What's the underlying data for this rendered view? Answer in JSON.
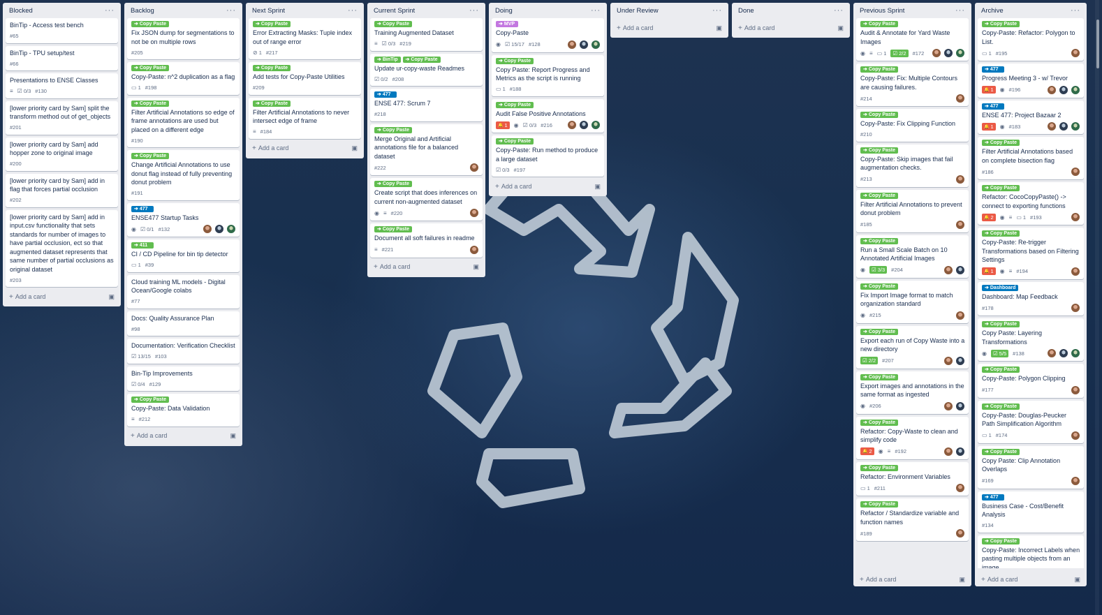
{
  "colors": {
    "green": "#61bd4f",
    "blue": "#0079bf",
    "purple": "#c377e0",
    "red": "#eb5a46"
  },
  "add_card_label": "Add a card",
  "lists": [
    {
      "title": "Blocked",
      "cards": [
        {
          "title": "BinTip - Access test bench",
          "num": "#65"
        },
        {
          "title": "BinTip - TPU setup/test",
          "num": "#66"
        },
        {
          "title": "Presentations to ENSE Classes",
          "check": "0/3",
          "desc": true,
          "num": "#130"
        },
        {
          "title": "[lower priority card by Sam] split the transform method out of get_objects",
          "num": "#201"
        },
        {
          "title": "[lower priority card by Sam] add hopper zone to original image",
          "num": "#200"
        },
        {
          "title": "[lower priority card by Sam] add in flag that forces partial occlusion",
          "num": "#202"
        },
        {
          "title": "[lower priority card by Sam] add in input.csv functionality that sets standards for number of images to have partial occlusion, ect so that augmented dataset represents that same number of partial occlusions as original dataset",
          "num": "#203"
        }
      ]
    },
    {
      "title": "Backlog",
      "cards": [
        {
          "labels": [
            {
              "text": "Copy Paste",
              "color": "green"
            }
          ],
          "title": "Fix JSON dump for segmentations to not be on multiple rows",
          "num": "#205"
        },
        {
          "labels": [
            {
              "text": "Copy Paste",
              "color": "green"
            }
          ],
          "title": "Copy-Paste: n^2 duplication as a flag",
          "comments": "1",
          "num": "#198"
        },
        {
          "labels": [
            {
              "text": "Copy Paste",
              "color": "green"
            }
          ],
          "title": "Filter Artificial Annotations so edge of frame annotations are used but placed on a different edge",
          "num": "#190"
        },
        {
          "labels": [
            {
              "text": "Copy Paste",
              "color": "green"
            }
          ],
          "title": "Change Artificial Annotations to use donut flag instead of fully preventing donut problem",
          "num": "#191"
        },
        {
          "labels": [
            {
              "text": "477",
              "color": "blue"
            }
          ],
          "title": "ENSE477 Startup Tasks",
          "watch": true,
          "check": "0/1",
          "num": "#132",
          "avatars": 3
        },
        {
          "labels": [
            {
              "text": "411",
              "color": "green"
            }
          ],
          "title": "CI / CD Pipeline for bin tip detector",
          "comments": "1",
          "num": "#39"
        },
        {
          "title": "Cloud training ML models - Digital Ocean/Google colabs",
          "num": "#77"
        },
        {
          "title": "Docs: Quality Assurance Plan",
          "num": "#98"
        },
        {
          "title": "Documentation: Verification Checklist",
          "check": "13/15",
          "num": "#103"
        },
        {
          "title": "Bin-Tip Improvements",
          "check": "0/4",
          "num": "#129"
        },
        {
          "labels": [
            {
              "text": "Copy Paste",
              "color": "green"
            }
          ],
          "title": "Copy-Paste: Data Validation",
          "desc": true,
          "num": "#212"
        }
      ]
    },
    {
      "title": "Next Sprint",
      "cards": [
        {
          "labels": [
            {
              "text": "Copy Paste",
              "color": "green"
            }
          ],
          "title": "Error Extracting Masks: Tuple index out of range error",
          "attach": "1",
          "num": "#217"
        },
        {
          "labels": [
            {
              "text": "Copy Paste",
              "color": "green"
            }
          ],
          "title": "Add tests for Copy-Paste Utilities",
          "num": "#209"
        },
        {
          "labels": [
            {
              "text": "Copy Paste",
              "color": "green"
            }
          ],
          "title": "Filter Artificial Annotations to never intersect edge of frame",
          "desc": true,
          "num": "#184"
        }
      ]
    },
    {
      "title": "Current Sprint",
      "cards": [
        {
          "labels": [
            {
              "text": "Copy Paste",
              "color": "green"
            }
          ],
          "title": "Training Augmented Dataset",
          "desc": true,
          "check": "0/3",
          "num": "#219"
        },
        {
          "labels": [
            {
              "text": "BinTip",
              "color": "green"
            },
            {
              "text": "Copy Paste",
              "color": "green"
            }
          ],
          "title": "Update ur-copy-waste Readmes",
          "check": "0/2",
          "num": "#208"
        },
        {
          "labels": [
            {
              "text": "477",
              "color": "blue"
            }
          ],
          "title": "ENSE 477: Scrum 7",
          "num": "#218"
        },
        {
          "labels": [
            {
              "text": "Copy Paste",
              "color": "green"
            }
          ],
          "title": "Merge Original and Artificial annotations file for a balanced dataset",
          "num": "#222",
          "avatars": 1
        },
        {
          "labels": [
            {
              "text": "Copy Paste",
              "color": "green"
            }
          ],
          "title": "Create script that does inferences on current non-augmented dataset",
          "watch": true,
          "desc": true,
          "num": "#220",
          "avatars": 1
        },
        {
          "labels": [
            {
              "text": "Copy Paste",
              "color": "green"
            }
          ],
          "title": "Document all soft failures in readme",
          "desc": true,
          "num": "#221",
          "avatars": 1
        }
      ]
    },
    {
      "title": "Doing",
      "cards": [
        {
          "labels": [
            {
              "text": "MVP",
              "color": "purple"
            }
          ],
          "title": "Copy-Paste",
          "watch": true,
          "check": "15/17",
          "num": "#128",
          "avatars": 3
        },
        {
          "labels": [
            {
              "text": "Copy Paste",
              "color": "green"
            }
          ],
          "title": "Copy Paste: Report Progress and Metrics as the script is running",
          "comments": "1",
          "num": "#188"
        },
        {
          "labels": [
            {
              "text": "Copy Paste",
              "color": "green"
            }
          ],
          "title": "Audit False Positive Annotations",
          "alert": "1",
          "watch": true,
          "check": "0/3",
          "num": "#216",
          "avatars": 3
        },
        {
          "labels": [
            {
              "text": "Copy Paste",
              "color": "green"
            }
          ],
          "title": "Copy-Paste: Run method to produce a large dataset",
          "check": "0/3",
          "num": "#197"
        }
      ]
    },
    {
      "title": "Under Review",
      "cards": []
    },
    {
      "title": "Done",
      "cards": []
    },
    {
      "title": "Previous Sprint",
      "cards": [
        {
          "labels": [
            {
              "text": "Copy Paste",
              "color": "green"
            }
          ],
          "title": "Audit & Annotate for Yard Waste Images",
          "watch": true,
          "desc": true,
          "comments": "1",
          "checkgreen": "2/2",
          "num": "#172",
          "avatars": 3
        },
        {
          "labels": [
            {
              "text": "Copy Paste",
              "color": "green"
            }
          ],
          "title": "Copy-Paste: Fix: Multiple Contours are causing failures.",
          "num": "#214",
          "avatars": 1
        },
        {
          "labels": [
            {
              "text": "Copy Paste",
              "color": "green"
            }
          ],
          "title": "Copy-Paste: Fix Clipping Function",
          "num": "#210"
        },
        {
          "labels": [
            {
              "text": "Copy Paste",
              "color": "green"
            }
          ],
          "title": "Copy-Paste: Skip images that fail augmentation checks.",
          "num": "#213",
          "avatars": 1
        },
        {
          "labels": [
            {
              "text": "Copy Paste",
              "color": "green"
            }
          ],
          "title": "Filter Artificial Annotations to prevent donut problem",
          "num": "#185",
          "avatars": 1
        },
        {
          "labels": [
            {
              "text": "Copy Paste",
              "color": "green"
            }
          ],
          "title": "Run a Small Scale Batch on 10 Annotated Artificial Images",
          "watch": true,
          "checkgreen": "3/3",
          "num": "#204",
          "avatars": 2
        },
        {
          "labels": [
            {
              "text": "Copy Paste",
              "color": "green"
            }
          ],
          "title": "Fix Import Image format to match organization standard",
          "watch": true,
          "num": "#215",
          "avatars": 1
        },
        {
          "labels": [
            {
              "text": "Copy Paste",
              "color": "green"
            }
          ],
          "title": "Export each run of Copy Waste into a new directory",
          "checkgreen": "2/2",
          "num": "#207",
          "avatars": 2
        },
        {
          "labels": [
            {
              "text": "Copy Paste",
              "color": "green"
            }
          ],
          "title": "Export images and annotations in the same format as ingested",
          "watch": true,
          "num": "#206",
          "avatars": 2
        },
        {
          "labels": [
            {
              "text": "Copy Paste",
              "color": "green"
            }
          ],
          "title": "Refactor: Copy-Waste to clean and simplify code",
          "alert": "2",
          "watch": true,
          "desc": true,
          "num": "#192",
          "avatars": 2
        },
        {
          "labels": [
            {
              "text": "Copy Paste",
              "color": "green"
            }
          ],
          "title": "Refactor: Environment Variables",
          "comments": "1",
          "num": "#211",
          "avatars": 1
        },
        {
          "labels": [
            {
              "text": "Copy Paste",
              "color": "green"
            }
          ],
          "title": "Refactor / Standardize variable and function names",
          "num": "#189",
          "avatars": 1
        }
      ]
    },
    {
      "title": "Archive",
      "cards": [
        {
          "labels": [
            {
              "text": "Copy Paste",
              "color": "green"
            }
          ],
          "title": "Copy-Paste: Refactor: Polygon to List.",
          "comments": "1",
          "num": "#195",
          "avatars": 1
        },
        {
          "labels": [
            {
              "text": "477",
              "color": "blue"
            }
          ],
          "title": "Progress Meeting 3 - w/ Trevor",
          "alert": "1",
          "watch": true,
          "num": "#196",
          "avatars": 3
        },
        {
          "labels": [
            {
              "text": "477",
              "color": "blue"
            }
          ],
          "title": "ENSE 477: Project Bazaar 2",
          "alert": "1",
          "watch": true,
          "num": "#183",
          "avatars": 3
        },
        {
          "labels": [
            {
              "text": "Copy Paste",
              "color": "green"
            }
          ],
          "title": "Filter Artificial Annotations based on complete bisection flag",
          "num": "#186",
          "avatars": 1
        },
        {
          "labels": [
            {
              "text": "Copy Paste",
              "color": "green"
            }
          ],
          "title": "Refactor: CocoCopyPaste() -> connect to exporting functions",
          "alert": "2",
          "watch": true,
          "desc": true,
          "comments": "1",
          "num": "#193",
          "avatars": 1
        },
        {
          "labels": [
            {
              "text": "Copy Paste",
              "color": "green"
            }
          ],
          "title": "Copy-Paste: Re-trigger Transformations based on Filtering Settings",
          "alert": "1",
          "watch": true,
          "desc": true,
          "num": "#194",
          "avatars": 1
        },
        {
          "labels": [
            {
              "text": "Dashboard",
              "color": "blue"
            }
          ],
          "title": "Dashboard: Map Feedback",
          "num": "#178",
          "avatars": 1
        },
        {
          "labels": [
            {
              "text": "Copy Paste",
              "color": "green"
            }
          ],
          "title": "Copy Paste: Layering Transformations",
          "watch": true,
          "checkgreen": "5/5",
          "num": "#138",
          "avatars": 3
        },
        {
          "labels": [
            {
              "text": "Copy Paste",
              "color": "green"
            }
          ],
          "title": "Copy-Paste: Polygon Clipping",
          "num": "#177",
          "avatars": 1
        },
        {
          "labels": [
            {
              "text": "Copy Paste",
              "color": "green"
            }
          ],
          "title": "Copy-Paste: Douglas-Peucker Path Simplification Algorithm",
          "comments": "1",
          "num": "#174",
          "avatars": 1
        },
        {
          "labels": [
            {
              "text": "Copy Paste",
              "color": "green"
            }
          ],
          "title": "Copy Paste: Clip Annotation Overlaps",
          "num": "#169",
          "avatars": 1
        },
        {
          "labels": [
            {
              "text": "477",
              "color": "blue"
            }
          ],
          "title": "Business Case - Cost/Benefit Analysis",
          "num": "#134"
        },
        {
          "labels": [
            {
              "text": "Copy Paste",
              "color": "green"
            }
          ],
          "title": "Copy-Paste: Incorrect Labels when pasting multiple objects from an image"
        }
      ]
    }
  ]
}
